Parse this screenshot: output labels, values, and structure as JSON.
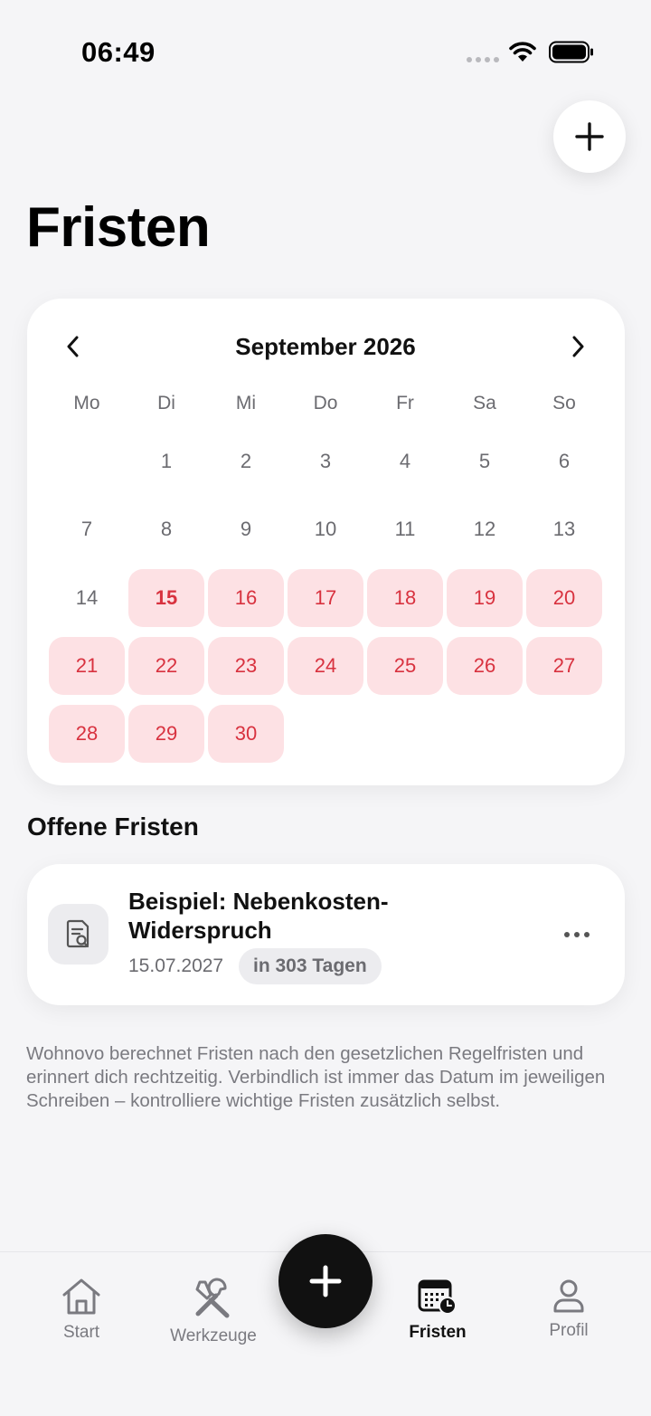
{
  "status_bar": {
    "time": "06:49"
  },
  "page": {
    "title": "Fristen"
  },
  "calendar": {
    "month_label": "September 2026",
    "weekdays": [
      "Mo",
      "Di",
      "Mi",
      "Do",
      "Fr",
      "Sa",
      "So"
    ],
    "first_weekday_offset": 1,
    "days_in_month": 30,
    "marked_days": [
      15,
      16,
      17,
      18,
      19,
      20,
      21,
      22,
      23,
      24,
      25,
      26,
      27,
      28,
      29,
      30
    ],
    "today": 15,
    "colors": {
      "marked_bg": "#fde1e4",
      "marked_text": "#d8323f"
    }
  },
  "open_deadlines": {
    "section_title": "Offene Fristen",
    "items": [
      {
        "title": "Beispiel: Nebenkosten-Widerspruch",
        "date": "15.07.2027",
        "badge": "in 303 Tagen",
        "icon": "document-search-icon"
      }
    ]
  },
  "disclaimer": "Wohnovo berechnet Fristen nach den gesetzlichen Regelfristen und erinnert dich rechtzeitig. Verbindlich ist immer das Datum im jeweiligen Schreiben – kontrolliere wichtige Fristen zusätzlich selbst.",
  "nav": {
    "items": [
      {
        "label": "Start",
        "icon": "home-icon"
      },
      {
        "label": "Werkzeuge",
        "icon": "tools-icon"
      },
      {
        "label": "Fristen",
        "icon": "calendar-clock-icon",
        "active": true
      },
      {
        "label": "Profil",
        "icon": "person-icon"
      }
    ],
    "fab_icon": "plus-icon"
  }
}
